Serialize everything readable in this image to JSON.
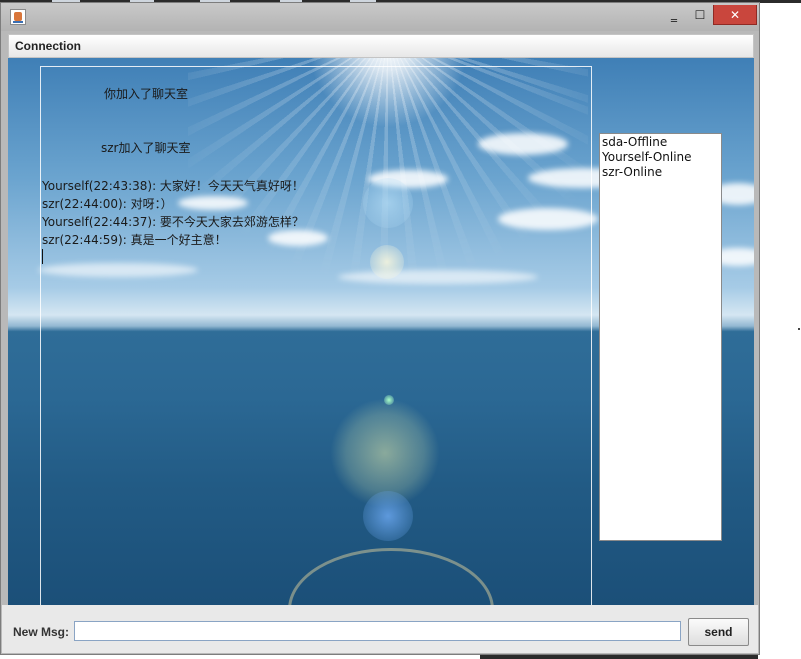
{
  "window": {
    "title": "",
    "controls": {
      "minimize": "‗",
      "maximize": "☐",
      "close": "✕"
    }
  },
  "menu": {
    "connection": "Connection"
  },
  "chat": {
    "system_messages": [
      "你加入了聊天室",
      "szr加入了聊天室"
    ],
    "lines": [
      "Yourself(22:43:38): 大家好！今天天气真好呀！",
      "szr(22:44:00): 对呀：）",
      "Yourself(22:44:37): 要不今天大家去郊游怎样？",
      "szr(22:44:59): 真是一个好主意！"
    ]
  },
  "users": [
    "sda-Offline",
    "Yourself-Online",
    "szr-Online"
  ],
  "input": {
    "label": "New Msg:",
    "value": "",
    "placeholder": ""
  },
  "send_button": "send"
}
